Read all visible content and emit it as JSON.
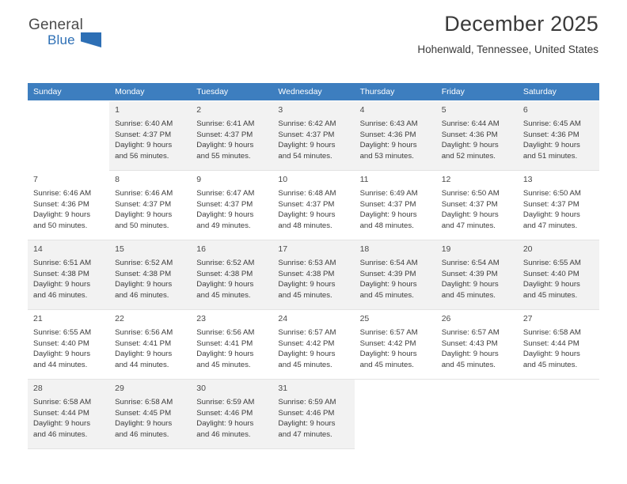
{
  "brand": {
    "name_top": "General",
    "name_bottom": "Blue",
    "flag_icon": "flag-icon",
    "accent_color": "#2d6fb5"
  },
  "header": {
    "month_title": "December 2025",
    "location": "Hohenwald, Tennessee, United States"
  },
  "calendar": {
    "header_bg": "#3d7ebf",
    "weekdays": [
      "Sunday",
      "Monday",
      "Tuesday",
      "Wednesday",
      "Thursday",
      "Friday",
      "Saturday"
    ],
    "weeks": [
      [
        {
          "day": ""
        },
        {
          "day": "1",
          "sunrise": "Sunrise: 6:40 AM",
          "sunset": "Sunset: 4:37 PM",
          "daylight1": "Daylight: 9 hours",
          "daylight2": "and 56 minutes."
        },
        {
          "day": "2",
          "sunrise": "Sunrise: 6:41 AM",
          "sunset": "Sunset: 4:37 PM",
          "daylight1": "Daylight: 9 hours",
          "daylight2": "and 55 minutes."
        },
        {
          "day": "3",
          "sunrise": "Sunrise: 6:42 AM",
          "sunset": "Sunset: 4:37 PM",
          "daylight1": "Daylight: 9 hours",
          "daylight2": "and 54 minutes."
        },
        {
          "day": "4",
          "sunrise": "Sunrise: 6:43 AM",
          "sunset": "Sunset: 4:36 PM",
          "daylight1": "Daylight: 9 hours",
          "daylight2": "and 53 minutes."
        },
        {
          "day": "5",
          "sunrise": "Sunrise: 6:44 AM",
          "sunset": "Sunset: 4:36 PM",
          "daylight1": "Daylight: 9 hours",
          "daylight2": "and 52 minutes."
        },
        {
          "day": "6",
          "sunrise": "Sunrise: 6:45 AM",
          "sunset": "Sunset: 4:36 PM",
          "daylight1": "Daylight: 9 hours",
          "daylight2": "and 51 minutes."
        }
      ],
      [
        {
          "day": "7",
          "sunrise": "Sunrise: 6:46 AM",
          "sunset": "Sunset: 4:36 PM",
          "daylight1": "Daylight: 9 hours",
          "daylight2": "and 50 minutes."
        },
        {
          "day": "8",
          "sunrise": "Sunrise: 6:46 AM",
          "sunset": "Sunset: 4:37 PM",
          "daylight1": "Daylight: 9 hours",
          "daylight2": "and 50 minutes."
        },
        {
          "day": "9",
          "sunrise": "Sunrise: 6:47 AM",
          "sunset": "Sunset: 4:37 PM",
          "daylight1": "Daylight: 9 hours",
          "daylight2": "and 49 minutes."
        },
        {
          "day": "10",
          "sunrise": "Sunrise: 6:48 AM",
          "sunset": "Sunset: 4:37 PM",
          "daylight1": "Daylight: 9 hours",
          "daylight2": "and 48 minutes."
        },
        {
          "day": "11",
          "sunrise": "Sunrise: 6:49 AM",
          "sunset": "Sunset: 4:37 PM",
          "daylight1": "Daylight: 9 hours",
          "daylight2": "and 48 minutes."
        },
        {
          "day": "12",
          "sunrise": "Sunrise: 6:50 AM",
          "sunset": "Sunset: 4:37 PM",
          "daylight1": "Daylight: 9 hours",
          "daylight2": "and 47 minutes."
        },
        {
          "day": "13",
          "sunrise": "Sunrise: 6:50 AM",
          "sunset": "Sunset: 4:37 PM",
          "daylight1": "Daylight: 9 hours",
          "daylight2": "and 47 minutes."
        }
      ],
      [
        {
          "day": "14",
          "sunrise": "Sunrise: 6:51 AM",
          "sunset": "Sunset: 4:38 PM",
          "daylight1": "Daylight: 9 hours",
          "daylight2": "and 46 minutes."
        },
        {
          "day": "15",
          "sunrise": "Sunrise: 6:52 AM",
          "sunset": "Sunset: 4:38 PM",
          "daylight1": "Daylight: 9 hours",
          "daylight2": "and 46 minutes."
        },
        {
          "day": "16",
          "sunrise": "Sunrise: 6:52 AM",
          "sunset": "Sunset: 4:38 PM",
          "daylight1": "Daylight: 9 hours",
          "daylight2": "and 45 minutes."
        },
        {
          "day": "17",
          "sunrise": "Sunrise: 6:53 AM",
          "sunset": "Sunset: 4:38 PM",
          "daylight1": "Daylight: 9 hours",
          "daylight2": "and 45 minutes."
        },
        {
          "day": "18",
          "sunrise": "Sunrise: 6:54 AM",
          "sunset": "Sunset: 4:39 PM",
          "daylight1": "Daylight: 9 hours",
          "daylight2": "and 45 minutes."
        },
        {
          "day": "19",
          "sunrise": "Sunrise: 6:54 AM",
          "sunset": "Sunset: 4:39 PM",
          "daylight1": "Daylight: 9 hours",
          "daylight2": "and 45 minutes."
        },
        {
          "day": "20",
          "sunrise": "Sunrise: 6:55 AM",
          "sunset": "Sunset: 4:40 PM",
          "daylight1": "Daylight: 9 hours",
          "daylight2": "and 45 minutes."
        }
      ],
      [
        {
          "day": "21",
          "sunrise": "Sunrise: 6:55 AM",
          "sunset": "Sunset: 4:40 PM",
          "daylight1": "Daylight: 9 hours",
          "daylight2": "and 44 minutes."
        },
        {
          "day": "22",
          "sunrise": "Sunrise: 6:56 AM",
          "sunset": "Sunset: 4:41 PM",
          "daylight1": "Daylight: 9 hours",
          "daylight2": "and 44 minutes."
        },
        {
          "day": "23",
          "sunrise": "Sunrise: 6:56 AM",
          "sunset": "Sunset: 4:41 PM",
          "daylight1": "Daylight: 9 hours",
          "daylight2": "and 45 minutes."
        },
        {
          "day": "24",
          "sunrise": "Sunrise: 6:57 AM",
          "sunset": "Sunset: 4:42 PM",
          "daylight1": "Daylight: 9 hours",
          "daylight2": "and 45 minutes."
        },
        {
          "day": "25",
          "sunrise": "Sunrise: 6:57 AM",
          "sunset": "Sunset: 4:42 PM",
          "daylight1": "Daylight: 9 hours",
          "daylight2": "and 45 minutes."
        },
        {
          "day": "26",
          "sunrise": "Sunrise: 6:57 AM",
          "sunset": "Sunset: 4:43 PM",
          "daylight1": "Daylight: 9 hours",
          "daylight2": "and 45 minutes."
        },
        {
          "day": "27",
          "sunrise": "Sunrise: 6:58 AM",
          "sunset": "Sunset: 4:44 PM",
          "daylight1": "Daylight: 9 hours",
          "daylight2": "and 45 minutes."
        }
      ],
      [
        {
          "day": "28",
          "sunrise": "Sunrise: 6:58 AM",
          "sunset": "Sunset: 4:44 PM",
          "daylight1": "Daylight: 9 hours",
          "daylight2": "and 46 minutes."
        },
        {
          "day": "29",
          "sunrise": "Sunrise: 6:58 AM",
          "sunset": "Sunset: 4:45 PM",
          "daylight1": "Daylight: 9 hours",
          "daylight2": "and 46 minutes."
        },
        {
          "day": "30",
          "sunrise": "Sunrise: 6:59 AM",
          "sunset": "Sunset: 4:46 PM",
          "daylight1": "Daylight: 9 hours",
          "daylight2": "and 46 minutes."
        },
        {
          "day": "31",
          "sunrise": "Sunrise: 6:59 AM",
          "sunset": "Sunset: 4:46 PM",
          "daylight1": "Daylight: 9 hours",
          "daylight2": "and 47 minutes."
        },
        {
          "day": ""
        },
        {
          "day": ""
        },
        {
          "day": ""
        }
      ]
    ]
  }
}
